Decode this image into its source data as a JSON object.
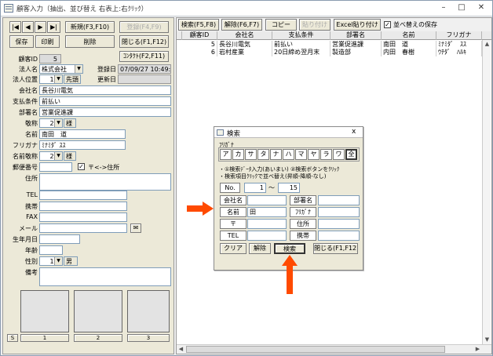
{
  "window": {
    "title": "顧客入力（抽出、並び替え 右表上:右ｸﾘｯｸ）",
    "btn_min": "–",
    "btn_max": "□",
    "btn_close": "✕"
  },
  "nav": {
    "first": "|◀",
    "prev": "◀",
    "next": "▶",
    "last": "▶|"
  },
  "buttons": {
    "new": "新規(F3,F10)",
    "register": "登録(F4,F9)",
    "save": "保存",
    "print": "印刷",
    "delete": "削除",
    "close": "閉じる(F1,F12)",
    "contact": "ｺﾝﾀｸﾄ(F2,F11)"
  },
  "form": {
    "customer_id_label": "顧客ID",
    "customer_id": "5",
    "corp_name_label": "法人名",
    "corp_name": "株式会社",
    "reg_date_label": "登録日",
    "reg_date": "07/09/27 10:49:14",
    "corp_pos_label": "法人位置",
    "corp_pos": "1",
    "corp_pos_text": "先頭",
    "upd_date_label": "更新日",
    "upd_date": "",
    "company_label": "会社名",
    "company": "長谷川電気",
    "payment_label": "支払条件",
    "payment": "前払い",
    "dept_label": "部署名",
    "dept": "営業促進課",
    "title_label": "敬称",
    "title_num": "2",
    "title_text": "様",
    "name_label": "名前",
    "name": "南田　道",
    "furigana_label": "フリガナ",
    "furigana": "ﾐﾅﾐﾀﾞ ｽｽ",
    "name_title_label": "名前敬称",
    "name_title_num": "2",
    "name_title_text": "様",
    "postal_label": "郵便番号",
    "postal": "",
    "postal_check": "〒<->住所",
    "address_label": "住所",
    "address": "",
    "tel_label": "TEL",
    "tel": "",
    "mobile_label": "携帯",
    "mobile": "",
    "fax_label": "FAX",
    "fax": "",
    "mail_label": "メール",
    "mail": "",
    "birth_label": "生年月日",
    "birth": "",
    "age_label": "年齢",
    "age": "",
    "gender_label": "性別",
    "gender_num": "1",
    "gender_text": "男",
    "notes_label": "備考",
    "notes": ""
  },
  "photos": {
    "s_label": "S",
    "labels": [
      "1",
      "2",
      "3"
    ]
  },
  "toolbar": {
    "search": "検索(F5,F8)",
    "clear": "解除(F6,F7)",
    "copy": "コピー",
    "paste": "貼り付け",
    "excel": "Excel貼り付け",
    "sort_save": "並べ替えの保存"
  },
  "table": {
    "headers": [
      "顧客ID",
      "会社名",
      "支払条件",
      "部署名",
      "名前",
      "フリガナ"
    ],
    "rows": [
      [
        "5",
        "長谷川電気",
        "前払い",
        "営業促進課",
        "南田　道",
        "ﾐﾅﾐﾀﾞ　ｽｽ"
      ],
      [
        "6",
        "岩村産業",
        "20日締め翌月末",
        "製造部",
        "内田　春樹",
        "ｳﾁﾀﾞ　ﾊﾙｷ"
      ]
    ]
  },
  "dialog": {
    "title": "検索",
    "furigana_label": "ﾌﾘｶﾞﾅ",
    "kana": [
      "ア",
      "カ",
      "サ",
      "タ",
      "ナ",
      "ハ",
      "マ",
      "ヤ",
      "ラ",
      "ワ",
      "全"
    ],
    "hint1": "・①検索ﾃﾞｰﾀ入力(あいまい) ②検索ボタンをｸﾘｯｸ",
    "hint2": "・検索項目ｸﾘｯｸで並べ替え(昇順-降順-なし)",
    "no_label": "No.",
    "no_from": "1",
    "tilde": "～",
    "no_to": "15",
    "fields": {
      "company": "会社名",
      "dept": "部署名",
      "name": "名前",
      "name_value": "田",
      "furigana": "ﾌﾘｶﾞﾅ",
      "postal": "〒",
      "address": "住所",
      "tel": "TEL",
      "mobile": "携帯"
    },
    "buttons": {
      "clear": "クリア",
      "release": "解除",
      "search": "検索",
      "close": "閉じる(F1,F12)"
    },
    "close_x": "x"
  },
  "colors": {
    "arrow": "#ff4a00"
  }
}
